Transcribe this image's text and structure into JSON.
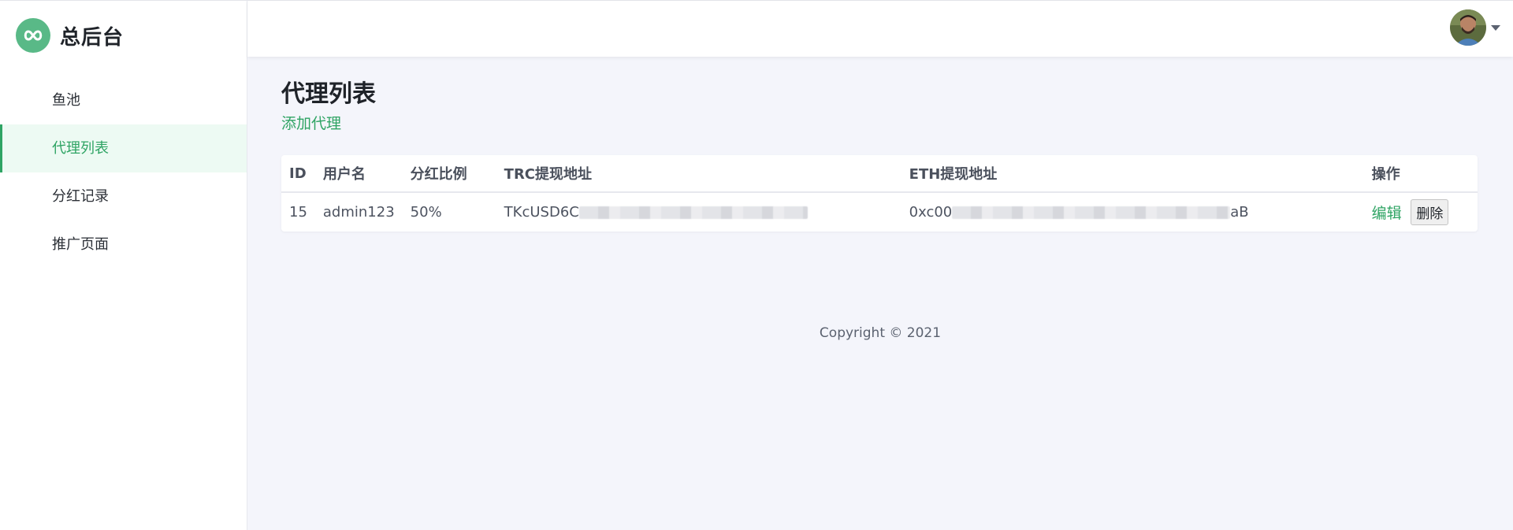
{
  "brand": {
    "name": "总后台"
  },
  "sidebar": {
    "items": [
      {
        "label": "鱼池",
        "active": false
      },
      {
        "label": "代理列表",
        "active": true
      },
      {
        "label": "分红记录",
        "active": false
      },
      {
        "label": "推广页面",
        "active": false
      }
    ]
  },
  "header": {
    "avatar_icon": "user-avatar",
    "menu_icon": "caret-down-icon"
  },
  "main": {
    "title": "代理列表",
    "add_link": "添加代理",
    "table": {
      "columns": [
        "ID",
        "用户名",
        "分红比例",
        "TRC提现地址",
        "ETH提现地址",
        "操作"
      ],
      "rows": [
        {
          "id": "15",
          "username": "admin123",
          "ratio": "50%",
          "trc_prefix": "TKcUSD6C",
          "trc_suffix": "",
          "eth_prefix": "0xc00",
          "eth_suffix": "aB",
          "edit_label": "编辑",
          "delete_label": "删除"
        }
      ]
    }
  },
  "footer": {
    "copyright": "Copyright © 2021"
  },
  "colors": {
    "accent": "#2fa464",
    "logo_bg": "#59b987",
    "active_bg": "#edfaf3",
    "page_bg": "#f4f5fb"
  }
}
